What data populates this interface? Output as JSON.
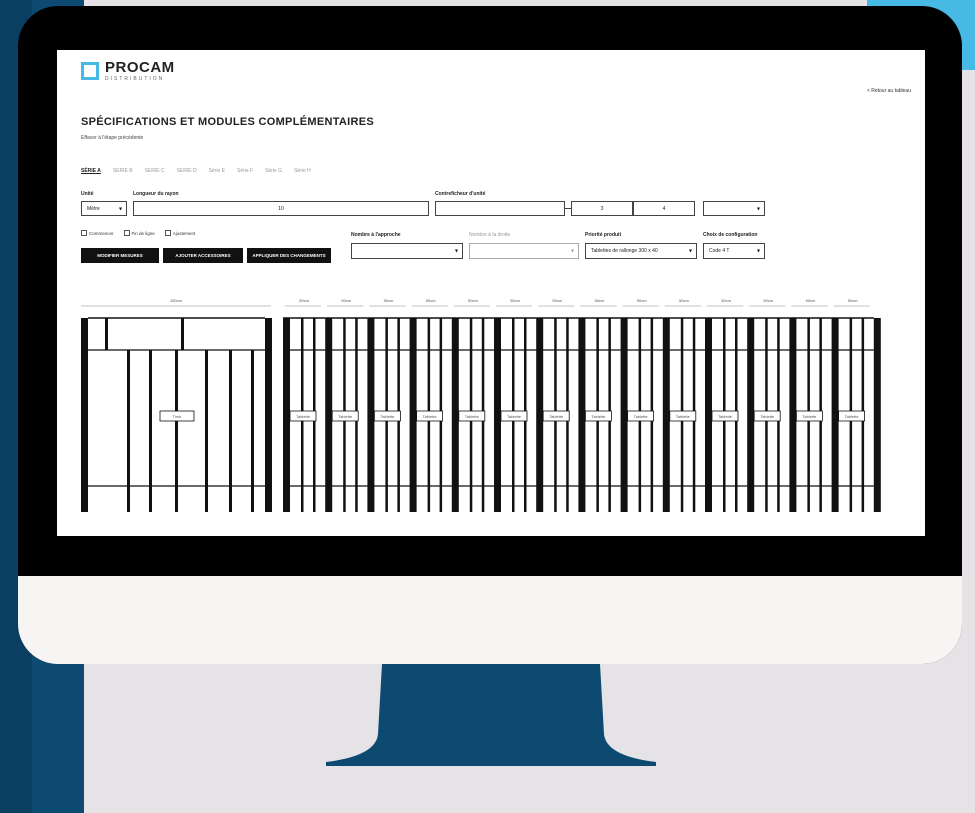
{
  "brand": {
    "name": "PROCAM",
    "tagline": "DISTRIBUTION",
    "accent": "#46b9e4",
    "navy": "#0c4a72"
  },
  "header": {
    "top_right_link": "< Retour au tableau"
  },
  "page": {
    "title": "SPÉCIFICATIONS ET MODULES COMPLÉMENTAIRES",
    "subtitle": "Effacer à l'étape précédente"
  },
  "tabs": [
    {
      "label": "SÉRIE A",
      "active": true
    },
    {
      "label": "SÉRIE B",
      "active": false
    },
    {
      "label": "SÉRIE C",
      "active": false
    },
    {
      "label": "SÉRIE D",
      "active": false
    },
    {
      "label": "Série E",
      "active": false
    },
    {
      "label": "Série F",
      "active": false
    },
    {
      "label": "Série G",
      "active": false
    },
    {
      "label": "Série H",
      "active": false
    }
  ],
  "form": {
    "unit_label": "Unité",
    "unit_value": "Mètre",
    "length_label": "Longueur du rayon",
    "length_value": "10",
    "shelf_label": "Contreficheur d'unité",
    "shelf_values": [
      "",
      "3",
      "4",
      ""
    ],
    "options": [
      {
        "label": "Commencer"
      },
      {
        "label": "Fin de ligne"
      },
      {
        "label": "Ajustement"
      }
    ],
    "shelf_count_label": "Nombre à l'approche",
    "shelf_count_value": "",
    "shelf_count2_label": "Nombre à la droite",
    "shelf_count2_value": "",
    "product_depth_label": "Priorité produit",
    "product_depth_value": "Tablettes de rallonge 300 x 40",
    "config_label": "Choix de configuration",
    "config_value": "Code 4 T"
  },
  "buttons": {
    "b1": "MODIFIER MESURES",
    "b2": "AJOUTER ACCESSOIRES",
    "b3": "APPLIQUER DES CHANGEMENTS"
  },
  "diagram": {
    "first_dim": "150cm",
    "section_dim": "50cm",
    "first_shelf_label": "Tiroir",
    "shelf_label": "Tablette",
    "section_count": 14
  }
}
